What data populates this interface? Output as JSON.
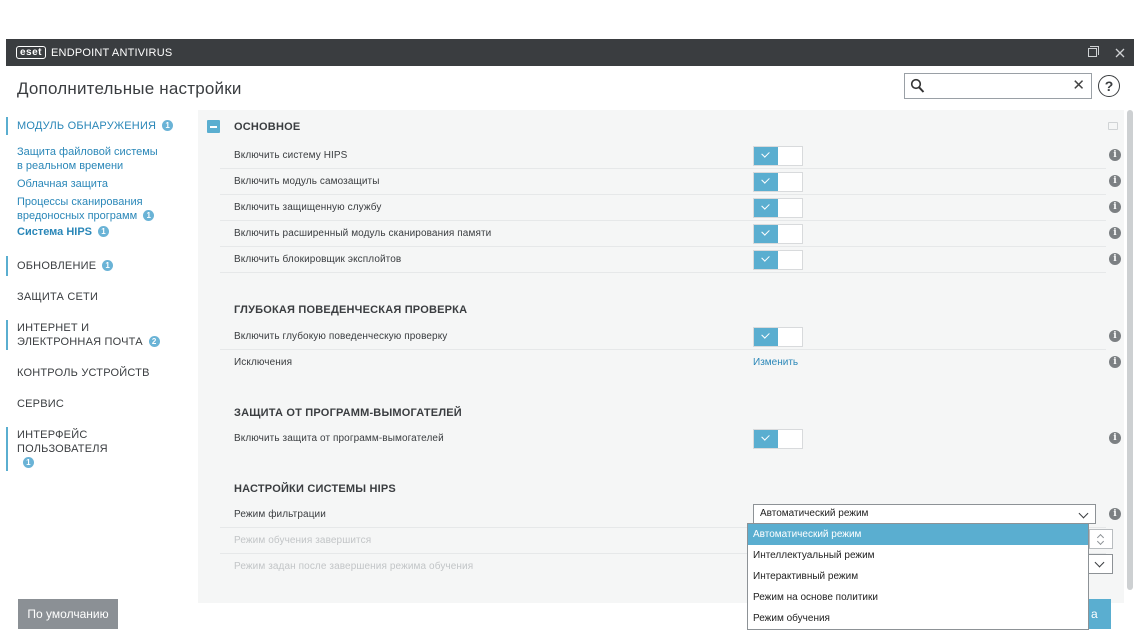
{
  "titlebar": {
    "logo": "eset",
    "product": "ENDPOINT ANTIVIRUS"
  },
  "header": {
    "title": "Дополнительные настройки",
    "search_value": "",
    "help_label": "?"
  },
  "sidebar": {
    "detection": {
      "label": "МОДУЛЬ ОБНАРУЖЕНИЯ",
      "badge": "1"
    },
    "sub_items": [
      {
        "label": "Защита файловой системы в реальном времени",
        "badge": ""
      },
      {
        "label": "Облачная защита",
        "badge": ""
      },
      {
        "label": "Процессы сканирования вредоносных программ",
        "badge": "1"
      },
      {
        "label": "Система HIPS",
        "badge": "1"
      }
    ],
    "update": {
      "label": "ОБНОВЛЕНИЕ",
      "badge": "1"
    },
    "network": {
      "label": "ЗАЩИТА СЕТИ"
    },
    "web": {
      "label": "ИНТЕРНЕТ И ЭЛЕКТРОННАЯ ПОЧТА",
      "badge": "2"
    },
    "devices": {
      "label": "КОНТРОЛЬ УСТРОЙСТВ"
    },
    "tools": {
      "label": "СЕРВИС"
    },
    "ui": {
      "label": "ИНТЕРФЕЙС ПОЛЬЗОВАТЕЛЯ",
      "badge": "1"
    }
  },
  "sections": {
    "basic": {
      "title": "ОСНОВНОЕ",
      "rows": [
        {
          "label": "Включить систему HIPS",
          "enabled": true
        },
        {
          "label": "Включить модуль самозащиты",
          "enabled": true
        },
        {
          "label": "Включить защищенную службу",
          "enabled": true
        },
        {
          "label": "Включить расширенный модуль сканирования памяти",
          "enabled": true
        },
        {
          "label": "Включить блокировщик эксплойтов",
          "enabled": true
        }
      ]
    },
    "deep": {
      "title": "ГЛУБОКАЯ ПОВЕДЕНЧЕСКАЯ ПРОВЕРКА",
      "rows": [
        {
          "label": "Включить глубокую поведенческую проверку",
          "enabled": true
        },
        {
          "label": "Исключения",
          "link": "Изменить"
        }
      ]
    },
    "ransom": {
      "title": "ЗАЩИТА ОТ ПРОГРАММ-ВЫМОГАТЕЛЕЙ",
      "rows": [
        {
          "label": "Включить защита от программ-вымогателей",
          "enabled": true
        }
      ]
    },
    "hips": {
      "title": "НАСТРОЙКИ СИСТЕМЫ HIPS",
      "rows": [
        {
          "label": "Режим фильтрации",
          "value": "Автоматический режим"
        },
        {
          "label": "Режим обучения завершится"
        },
        {
          "label": "Режим задан после завершения режима обучения"
        }
      ]
    }
  },
  "dropdown": {
    "options": [
      "Автоматический режим",
      "Интеллектуальный режим",
      "Интерактивный режим",
      "Режим на основе политики",
      "Режим обучения"
    ],
    "selected_index": 0
  },
  "footer": {
    "default_label": "По умолчанию",
    "ok_tail": "а"
  },
  "colors": {
    "accent": "#5aaed0",
    "titlebar": "#3a3d40",
    "link": "#2a87b8"
  }
}
